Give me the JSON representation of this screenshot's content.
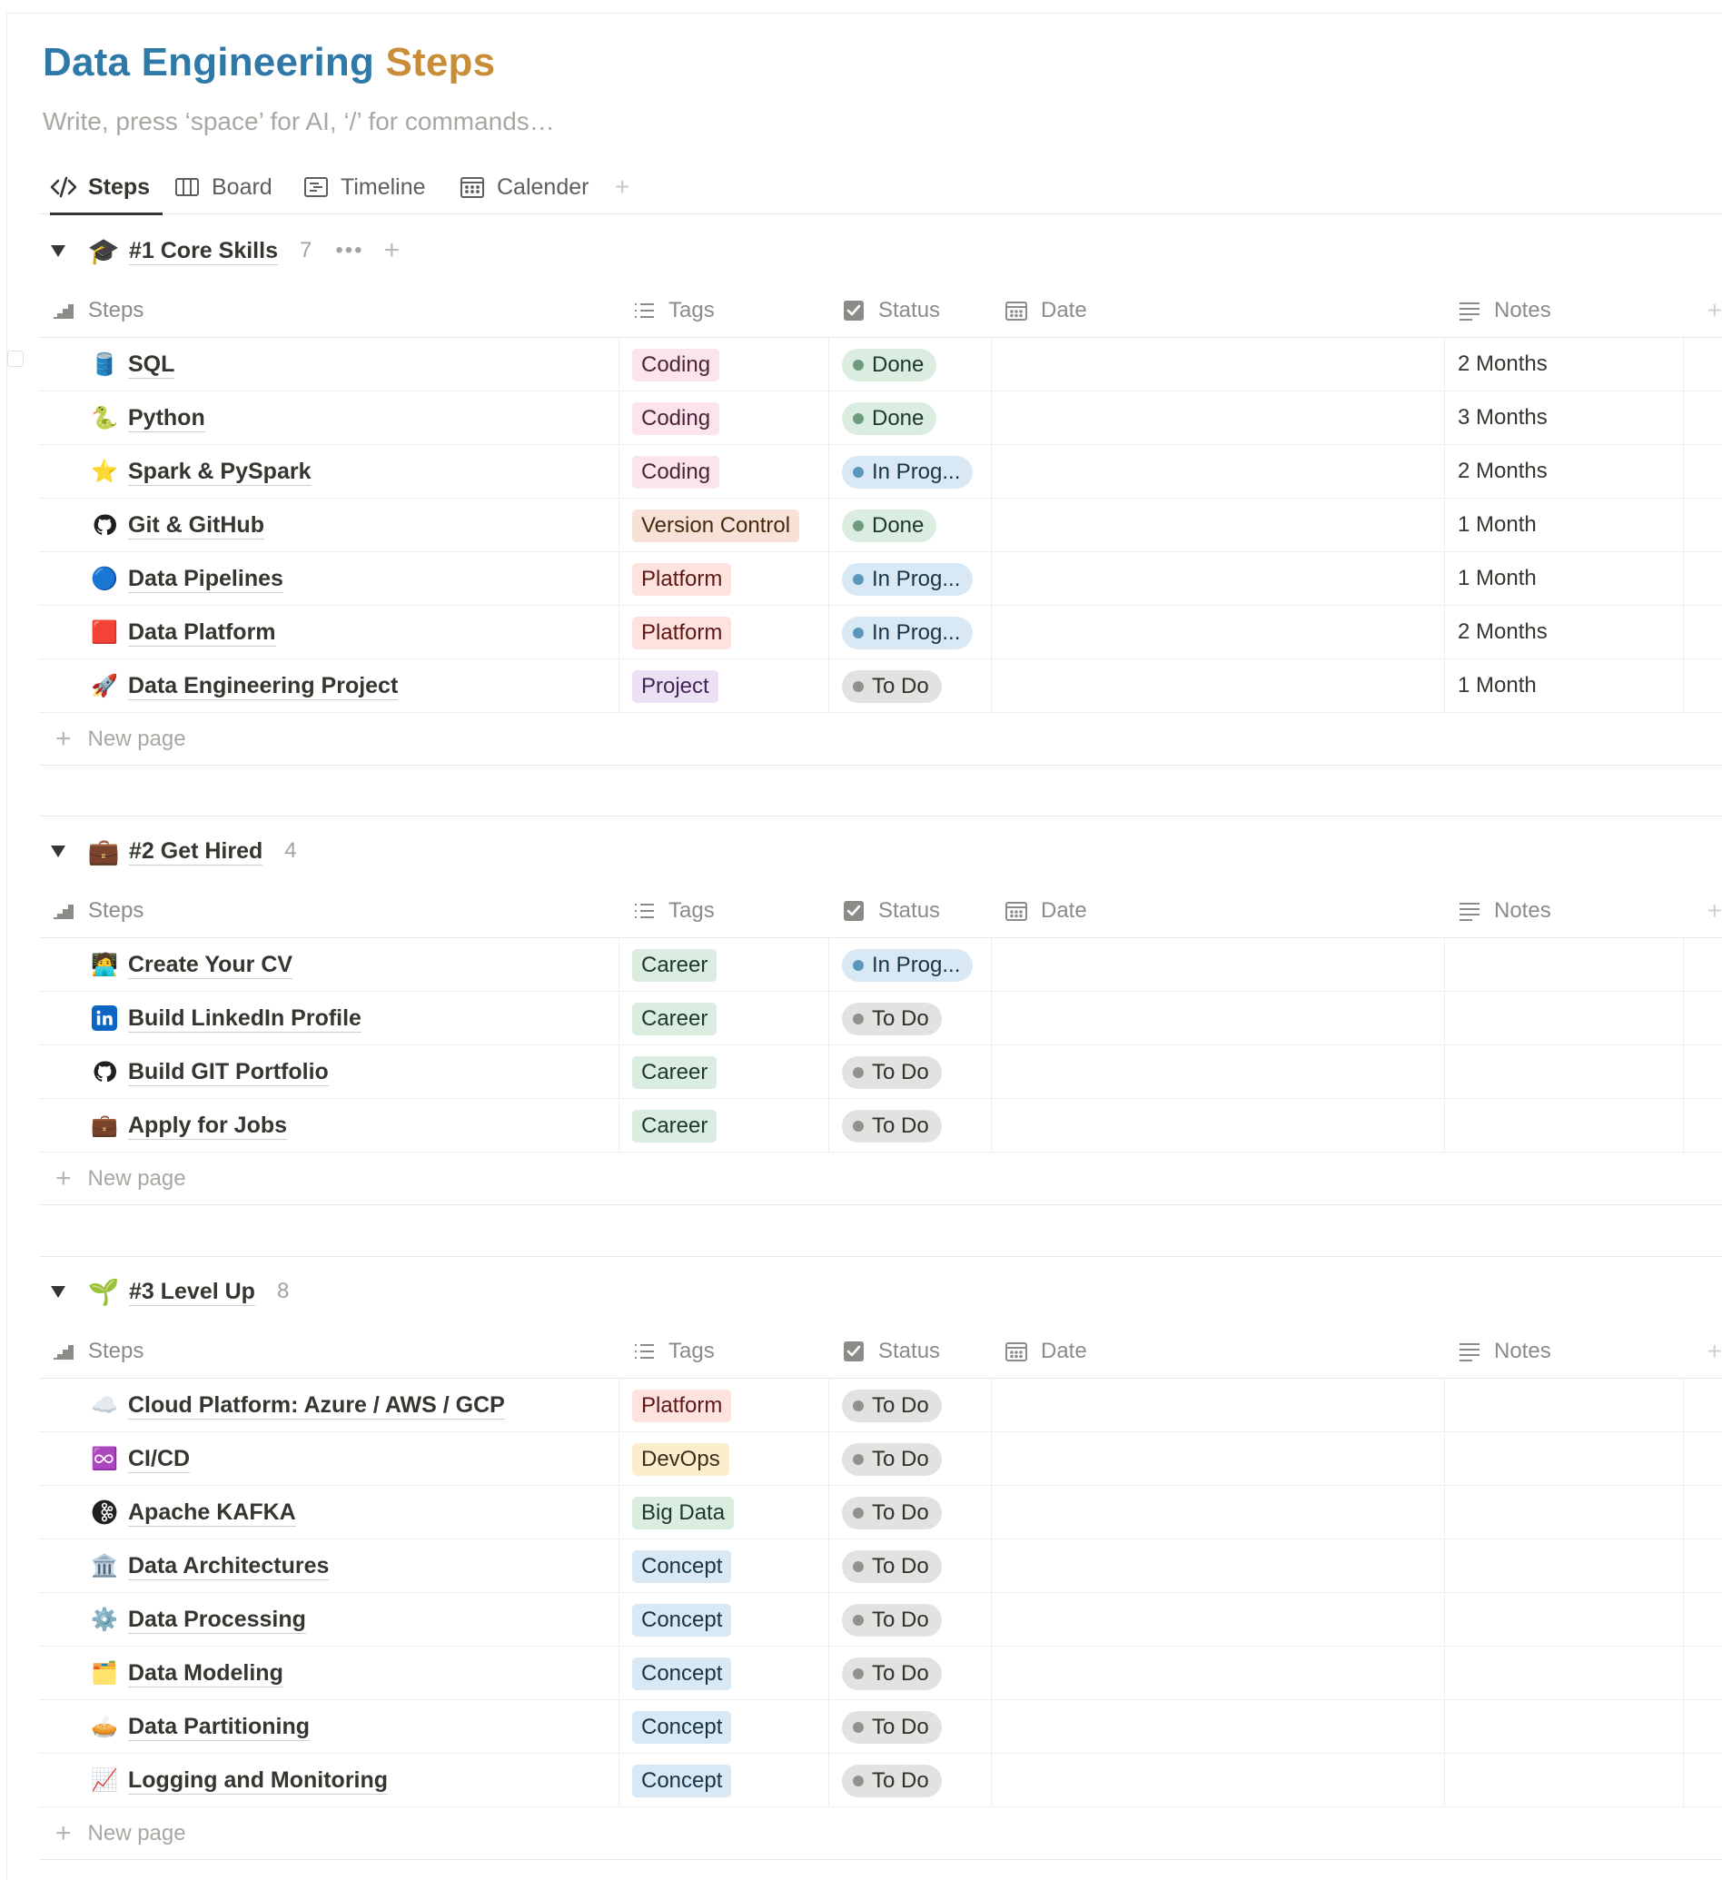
{
  "page": {
    "title_part1": "Data Engineering",
    "title_part2": "Steps",
    "subtitle": "Write, press ‘space’ for AI, ‘/’ for commands…"
  },
  "tabs": [
    {
      "label": "Steps",
      "icon": "code-icon",
      "active": true
    },
    {
      "label": "Board",
      "icon": "board-icon",
      "active": false
    },
    {
      "label": "Timeline",
      "icon": "timeline-icon",
      "active": false
    },
    {
      "label": "Calender",
      "icon": "calendar-icon",
      "active": false
    }
  ],
  "tab_add": "+",
  "columns": {
    "steps": "Steps",
    "tags": "Tags",
    "status": "Status",
    "date": "Date",
    "notes": "Notes",
    "add": "+"
  },
  "new_page_label": "New page",
  "tag_colors": {
    "Coding": {
      "bg": "#fbe4ec",
      "fg": "#4c2337"
    },
    "Version Control": {
      "bg": "#f7e2d8",
      "fg": "#49290e"
    },
    "Platform": {
      "bg": "#fde2dd",
      "fg": "#5d1715"
    },
    "Project": {
      "bg": "#ece0f4",
      "fg": "#412454"
    },
    "Career": {
      "bg": "#dbede0",
      "fg": "#1c3829"
    },
    "DevOps": {
      "bg": "#fbeecb",
      "fg": "#402c1b"
    },
    "Big Data": {
      "bg": "#dbede0",
      "fg": "#1c3829"
    },
    "Concept": {
      "bg": "#d8e9f5",
      "fg": "#183347"
    }
  },
  "status_colors": {
    "Done": {
      "bg": "#dbede0",
      "dot": "#6c9b7d",
      "fg": "#1c3829"
    },
    "In Prog...": {
      "bg": "#d8e9f5",
      "dot": "#5b97bd",
      "fg": "#183347"
    },
    "To Do": {
      "bg": "#e3e2e0",
      "dot": "#91918e",
      "fg": "#32302c"
    }
  },
  "groups": [
    {
      "title": "#1 Core Skills",
      "count": "7",
      "more": "•••",
      "plus": "+",
      "emoji": "🎓",
      "rows": [
        {
          "name": "SQL",
          "icon": "🛢️",
          "tag": "Coding",
          "status": "Done",
          "notes": "2 Months"
        },
        {
          "name": "Python",
          "icon": "🐍",
          "tag": "Coding",
          "status": "Done",
          "notes": "3 Months"
        },
        {
          "name": "Spark & PySpark",
          "icon": "⭐",
          "tag": "Coding",
          "status": "In Prog...",
          "notes": "2 Months"
        },
        {
          "name": "Git & GitHub",
          "icon": "github",
          "tag": "Version Control",
          "status": "Done",
          "notes": "1 Month"
        },
        {
          "name": "Data Pipelines",
          "icon": "🔵",
          "tag": "Platform",
          "status": "In Prog...",
          "notes": "1 Month"
        },
        {
          "name": "Data Platform",
          "icon": "🟥",
          "tag": "Platform",
          "status": "In Prog...",
          "notes": "2 Months"
        },
        {
          "name": "Data Engineering Project",
          "icon": "🚀",
          "tag": "Project",
          "status": "To Do",
          "notes": "1 Month"
        }
      ]
    },
    {
      "title": "#2 Get Hired",
      "count": "4",
      "more": "",
      "plus": "",
      "emoji": "💼",
      "rows": [
        {
          "name": "Create Your CV",
          "icon": "🧑‍💻",
          "tag": "Career",
          "status": "In Prog...",
          "notes": ""
        },
        {
          "name": "Build LinkedIn Profile",
          "icon": "linkedin",
          "tag": "Career",
          "status": "To Do",
          "notes": ""
        },
        {
          "name": "Build GIT Portfolio",
          "icon": "github",
          "tag": "Career",
          "status": "To Do",
          "notes": ""
        },
        {
          "name": "Apply for Jobs",
          "icon": "💼",
          "tag": "Career",
          "status": "To Do",
          "notes": ""
        }
      ]
    },
    {
      "title": "#3 Level Up",
      "count": "8",
      "more": "",
      "plus": "",
      "emoji": "🌱",
      "rows": [
        {
          "name": "Cloud Platform: Azure / AWS / GCP",
          "icon": "☁️",
          "tag": "Platform",
          "status": "To Do",
          "notes": ""
        },
        {
          "name": "CI/CD",
          "icon": "♾️",
          "tag": "DevOps",
          "status": "To Do",
          "notes": ""
        },
        {
          "name": "Apache KAFKA",
          "icon": "kafka",
          "tag": "Big Data",
          "status": "To Do",
          "notes": ""
        },
        {
          "name": "Data Architectures",
          "icon": "🏛️",
          "tag": "Concept",
          "status": "To Do",
          "notes": ""
        },
        {
          "name": "Data Processing",
          "icon": "⚙️",
          "tag": "Concept",
          "status": "To Do",
          "notes": ""
        },
        {
          "name": "Data Modeling",
          "icon": "🗂️",
          "tag": "Concept",
          "status": "To Do",
          "notes": ""
        },
        {
          "name": "Data Partitioning",
          "icon": "🥧",
          "tag": "Concept",
          "status": "To Do",
          "notes": ""
        },
        {
          "name": "Logging and Monitoring",
          "icon": "📈",
          "tag": "Concept",
          "status": "To Do",
          "notes": ""
        }
      ]
    }
  ]
}
